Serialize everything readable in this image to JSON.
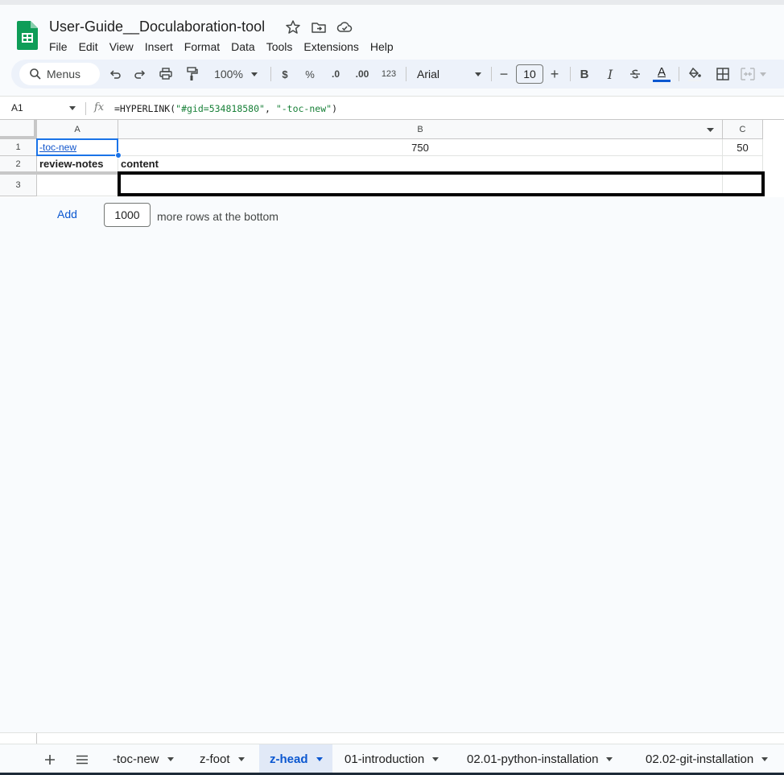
{
  "document": {
    "title": "User-Guide__Doculaboration-tool"
  },
  "menu": [
    "File",
    "Edit",
    "View",
    "Insert",
    "Format",
    "Data",
    "Tools",
    "Extensions",
    "Help"
  ],
  "toolbar": {
    "search_label": "Menus",
    "zoom": "100%",
    "currency": "$",
    "percent": "%",
    "decrease_decimal": ".0",
    "increase_decimal": ".00",
    "number_format": "123",
    "font": "Arial",
    "font_size": "10",
    "minus": "−",
    "plus": "+",
    "bold": "B",
    "italic": "I",
    "text_color_letter": "A",
    "text_color": "#0b57d0"
  },
  "formula_bar": {
    "name_box": "A1",
    "fx": "fx",
    "formula_prefix": "=HYPERLINK(",
    "formula_arg1": "\"#gid=534818580\"",
    "formula_comma": ", ",
    "formula_arg2": "\"-toc-new\"",
    "formula_suffix": ")"
  },
  "grid": {
    "columns": [
      "A",
      "B",
      "C"
    ],
    "rows": [
      "1",
      "2",
      "3"
    ],
    "cells": {
      "a1": "-toc-new",
      "b1": "750",
      "c1": "50",
      "a2": "review-notes",
      "b2": "content",
      "c2": "",
      "a3": "",
      "b3": "",
      "c3": ""
    }
  },
  "add_rows": {
    "button": "Add",
    "count": "1000",
    "suffix": "more rows at the bottom"
  },
  "sheets": {
    "tabs": [
      "-toc-new",
      "z-foot",
      "z-head",
      "01-introduction",
      "02.01-python-installation",
      "02.02-git-installation"
    ],
    "active": "z-head"
  }
}
